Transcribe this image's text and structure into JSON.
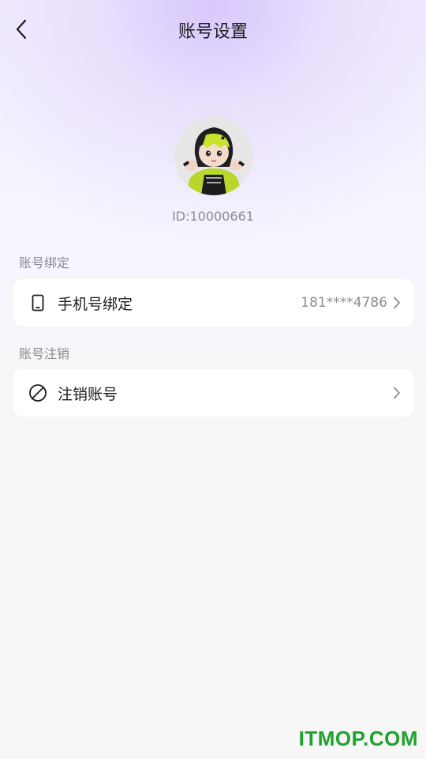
{
  "header": {
    "title": "账号设置",
    "back_icon": "chevron-left-icon"
  },
  "profile": {
    "user_id": "ID:10000661",
    "avatar": "avatar-image"
  },
  "sections": {
    "binding": {
      "label": "账号绑定"
    },
    "cancel": {
      "label": "账号注销"
    }
  },
  "items": {
    "phone": {
      "icon": "phone-icon",
      "label": "手机号绑定",
      "value": "181****4786"
    },
    "cancel_account": {
      "icon": "ban-icon",
      "label": "注销账号"
    }
  },
  "watermark": {
    "text": "ITMOP.COM",
    "color": "#1fa22e"
  }
}
